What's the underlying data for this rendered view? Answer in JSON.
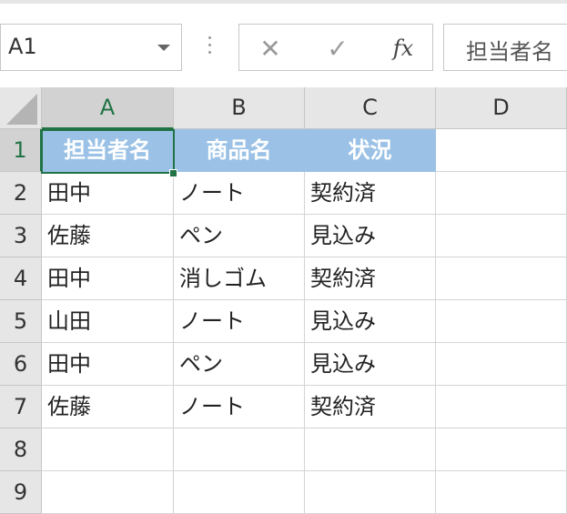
{
  "name_box": {
    "value": "A1"
  },
  "formula_bar": {
    "cancel_glyph": "✕",
    "enter_glyph": "✓",
    "fx_label": "fx",
    "value": "担当者名"
  },
  "columns": [
    "A",
    "B",
    "C",
    "D"
  ],
  "rows": [
    "1",
    "2",
    "3",
    "4",
    "5",
    "6",
    "7",
    "8",
    "9"
  ],
  "cells": [
    [
      "担当者名",
      "商品名",
      "状況",
      ""
    ],
    [
      "田中",
      "ノート",
      "契約済",
      ""
    ],
    [
      "佐藤",
      "ペン",
      "見込み",
      ""
    ],
    [
      "田中",
      "消しゴム",
      "契約済",
      ""
    ],
    [
      "山田",
      "ノート",
      "見込み",
      ""
    ],
    [
      "田中",
      "ペン",
      "見込み",
      ""
    ],
    [
      "佐藤",
      "ノート",
      "契約済",
      ""
    ],
    [
      "",
      "",
      "",
      ""
    ],
    [
      "",
      "",
      "",
      ""
    ]
  ],
  "colors": {
    "header_fill": "#9bc2e6",
    "accent": "#217346"
  }
}
